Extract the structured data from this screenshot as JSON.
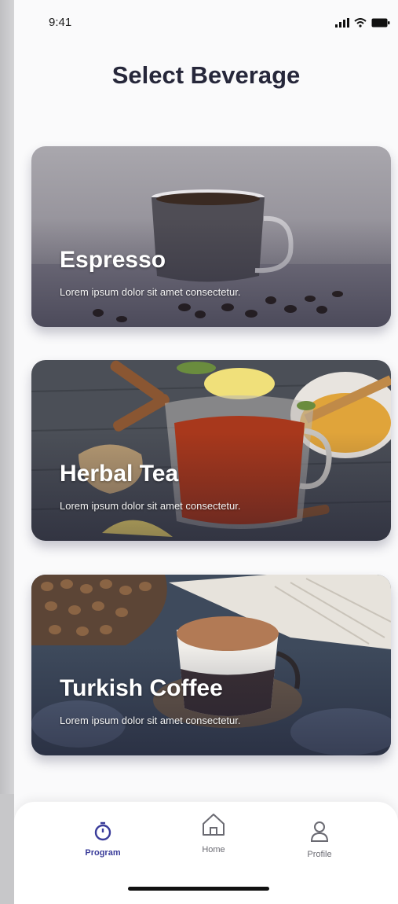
{
  "status": {
    "time": "9:41"
  },
  "page": {
    "title": "Select Beverage"
  },
  "cards": [
    {
      "title": "Espresso",
      "subtitle": "Lorem ipsum dolor sit amet consectetur."
    },
    {
      "title": "Herbal Tea",
      "subtitle": "Lorem ipsum dolor sit amet consectetur."
    },
    {
      "title": "Turkish Coffee",
      "subtitle": "Lorem ipsum dolor sit amet consectetur."
    }
  ],
  "tabs": [
    {
      "label": "Program",
      "icon": "timer-icon",
      "active": true
    },
    {
      "label": "Home",
      "icon": "home-icon",
      "active": false
    },
    {
      "label": "Profile",
      "icon": "user-icon",
      "active": false
    }
  ],
  "colors": {
    "accent": "#3a3c9a",
    "title": "#26273a"
  }
}
